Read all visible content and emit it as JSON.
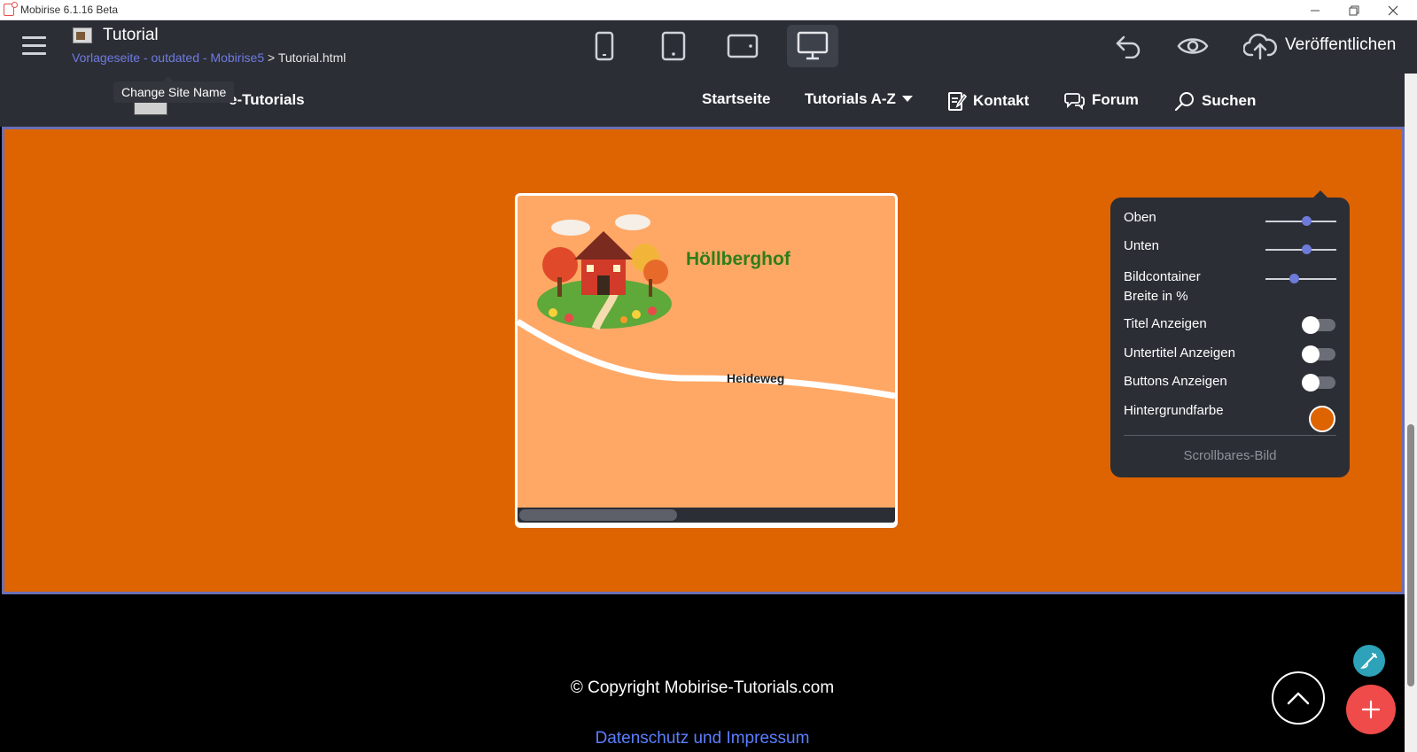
{
  "window": {
    "title": "Mobirise 6.1.16 Beta",
    "minimize_icon": "minimize-icon",
    "maximize_icon": "restore-icon",
    "close_icon": "close-icon"
  },
  "toolbar": {
    "menu_icon": "hamburger-menu-icon",
    "site_title": "Tutorial",
    "breadcrumb_link": "Vorlageseite - outdated - Mobirise5",
    "breadcrumb_separator": ">",
    "breadcrumb_page": "Tutorial.html",
    "devices": [
      {
        "name": "phone-portrait-icon",
        "active": false
      },
      {
        "name": "tablet-portrait-icon",
        "active": false
      },
      {
        "name": "tablet-landscape-icon",
        "active": false
      },
      {
        "name": "desktop-icon",
        "active": true
      }
    ],
    "undo_icon": "undo-icon",
    "preview_icon": "eye-icon",
    "publish_icon": "cloud-upload-icon",
    "publish_label": "Veröffentlichen"
  },
  "tooltip": {
    "text": "Change Site Name"
  },
  "site_nav": {
    "brand": "e-Tutorials",
    "items": [
      {
        "label": "Startseite",
        "icon": ""
      },
      {
        "label": "Tutorials A-Z",
        "icon": "caret-down-icon"
      },
      {
        "label": "Kontakt",
        "icon": "edit-document-icon"
      },
      {
        "label": "Forum",
        "icon": "chat-bubbles-icon"
      },
      {
        "label": "Suchen",
        "icon": "search-icon"
      }
    ]
  },
  "image_block": {
    "title": "Höllberghof",
    "road_label": "Heideweg"
  },
  "settings": {
    "sliders": [
      {
        "label": "Oben",
        "value": 0.58
      },
      {
        "label": "Unten",
        "value": 0.58
      },
      {
        "label": "Bildcontainer Breite in %",
        "value": 0.4
      }
    ],
    "toggles": [
      {
        "label": "Titel Anzeigen",
        "on": false
      },
      {
        "label": "Untertitel Anzeigen",
        "on": false
      },
      {
        "label": "Buttons Anzeigen",
        "on": false
      }
    ],
    "bg_color_label": "Hintergrundfarbe",
    "bg_color": "#dd6400",
    "footer": "Scrollbares-Bild"
  },
  "footer": {
    "copyright": "© Copyright Mobirise-Tutorials.com",
    "privacy": "Datenschutz und Impressum"
  },
  "colors": {
    "toolbar_bg": "#2b2e35",
    "section_bg": "#dd6400",
    "accent": "#6f7bd9",
    "fab_add": "#ef4b4b",
    "fab_brush": "#2da2b8"
  }
}
